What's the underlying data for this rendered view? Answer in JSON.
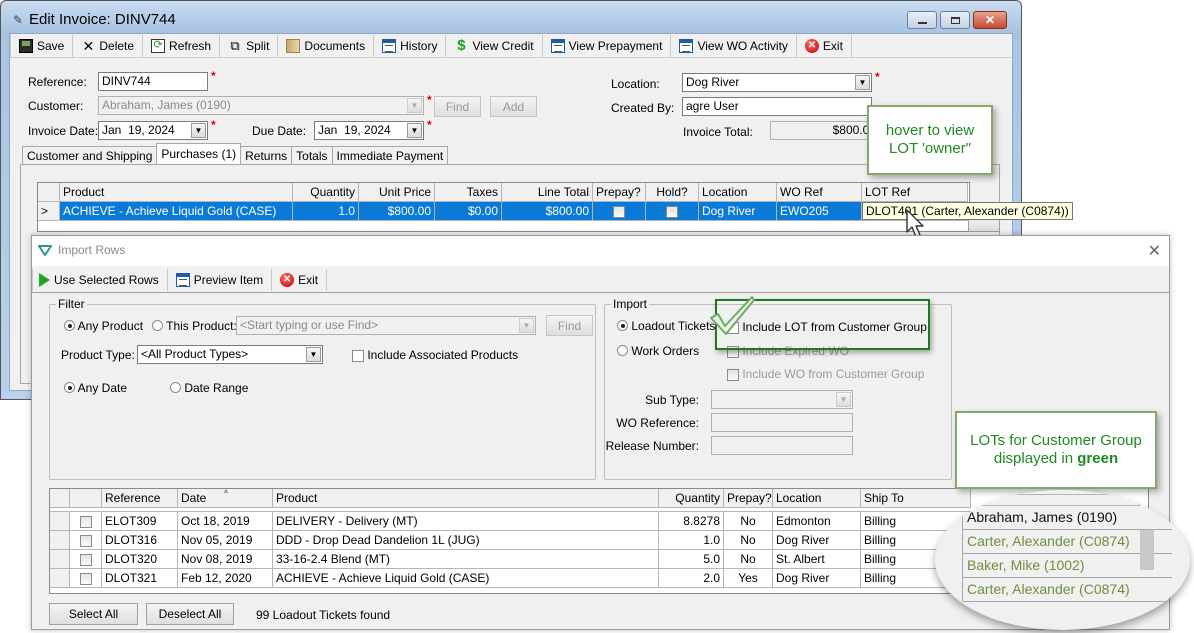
{
  "main_window": {
    "title": "Edit Invoice: DINV744",
    "toolbar": [
      {
        "id": "save",
        "label": "Save",
        "icon": "save-icon"
      },
      {
        "id": "delete",
        "label": "Delete",
        "icon": "x-icon"
      },
      {
        "id": "refresh",
        "label": "Refresh",
        "icon": "refresh-icon"
      },
      {
        "id": "split",
        "label": "Split",
        "icon": "split-icon"
      },
      {
        "id": "documents",
        "label": "Documents",
        "icon": "documents-icon"
      },
      {
        "id": "history",
        "label": "History",
        "icon": "list-icon"
      },
      {
        "id": "view-credit",
        "label": "View Credit",
        "icon": "dollar-icon"
      },
      {
        "id": "view-prepayment",
        "label": "View Prepayment",
        "icon": "list-icon"
      },
      {
        "id": "view-wo-activity",
        "label": "View WO Activity",
        "icon": "list-icon"
      },
      {
        "id": "exit",
        "label": "Exit",
        "icon": "exit-icon"
      }
    ],
    "form": {
      "reference_label": "Reference:",
      "reference_value": "DINV744",
      "customer_label": "Customer:",
      "customer_value": "Abraham, James (0190)",
      "find_label": "Find",
      "add_label": "Add",
      "invoice_date_label": "Invoice Date:",
      "invoice_date_value": "Jan  19, 2024",
      "due_date_label": "Due Date:",
      "due_date_value": "Jan  19, 2024",
      "location_label": "Location:",
      "location_value": "Dog River",
      "created_by_label": "Created By:",
      "created_by_value": "agre User",
      "invoice_total_label": "Invoice Total:",
      "invoice_total_value": "$800.00",
      "required_mark": "*"
    },
    "tabs": [
      "Customer and Shipping",
      "Purchases (1)",
      "Returns",
      "Totals",
      "Immediate Payment"
    ],
    "active_tab": "Purchases (1)",
    "grid": {
      "columns": [
        "Product",
        "Quantity",
        "Unit Price",
        "Taxes",
        "Line Total",
        "Prepay?",
        "Hold?",
        "Location",
        "WO Ref",
        "LOT Ref"
      ],
      "rows": [
        {
          "indicator": ">",
          "product": "ACHIEVE - Achieve Liquid Gold (CASE)",
          "quantity": "1.0",
          "unit_price": "$800.00",
          "taxes": "$0.00",
          "line_total": "$800.00",
          "prepay": false,
          "hold": false,
          "location": "Dog River",
          "wo_ref": "EWO205",
          "lot_ref": "DLOT401"
        }
      ]
    },
    "tooltip": "DLOT401 (Carter, Alexander (C0874))"
  },
  "callouts": {
    "hover": "hover to view LOT 'owner\"",
    "green_prefix": "LOTs for Customer Group displayed in ",
    "green_word": "green"
  },
  "import_window": {
    "title": "Import Rows",
    "toolbar": [
      {
        "id": "use-selected-rows",
        "label": "Use Selected Rows"
      },
      {
        "id": "preview-item",
        "label": "Preview Item"
      },
      {
        "id": "exit",
        "label": "Exit"
      }
    ],
    "filter": {
      "title": "Filter",
      "any_product": "Any Product",
      "this_product": "This Product:",
      "product_placeholder": "<Start typing or use Find>",
      "find_label": "Find",
      "product_type_label": "Product Type:",
      "product_type_value": "<All Product Types>",
      "include_associated": "Include Associated Products",
      "any_date": "Any Date",
      "date_range": "Date Range",
      "selected_product_option": "Any Product",
      "selected_date_option": "Any Date"
    },
    "import": {
      "title": "Import",
      "loadout_tickets": "Loadout Tickets",
      "work_orders": "Work Orders",
      "selected_option": "Loadout Tickets",
      "include_lot_customer_group": "Include LOT from Customer Group",
      "include_lot_customer_group_checked": true,
      "include_expired_wo": "Include Expired WO",
      "include_wo_customer_group": "Include WO from Customer Group",
      "sub_type_label": "Sub Type:",
      "wo_reference_label": "WO Reference:",
      "release_number_label": "Release Number:"
    },
    "grid": {
      "columns": [
        "Reference",
        "Date",
        "Product",
        "Quantity",
        "Prepay?",
        "Location",
        "Ship To"
      ],
      "rows": [
        {
          "reference": "ELOT309",
          "date": "Oct 18, 2019",
          "product": "DELIVERY - Delivery (MT)",
          "quantity": "8.8278",
          "prepay": "No",
          "location": "Edmonton",
          "ship_to": "Billing"
        },
        {
          "reference": "DLOT316",
          "date": "Nov 05, 2019",
          "product": "DDD - Drop Dead Dandelion 1L (JUG)",
          "quantity": "1.0",
          "prepay": "No",
          "location": "Dog River",
          "ship_to": "Billing"
        },
        {
          "reference": "DLOT320",
          "date": "Nov 08, 2019",
          "product": "33-16-2.4 Blend (MT)",
          "quantity": "5.0",
          "prepay": "No",
          "location": "St. Albert",
          "ship_to": "Billing"
        },
        {
          "reference": "DLOT321",
          "date": "Feb 12, 2020",
          "product": "ACHIEVE - Achieve Liquid Gold (CASE)",
          "quantity": "2.0",
          "prepay": "Yes",
          "location": "Dog River",
          "ship_to": "Billing"
        }
      ]
    },
    "select_all": "Select All",
    "deselect_all": "Deselect All",
    "status": "99 Loadout Tickets found"
  },
  "magnified_customers": [
    {
      "name": "Abraham, James (0190)",
      "group": false
    },
    {
      "name": "Carter, Alexander (C0874)",
      "group": true
    },
    {
      "name": "Baker, Mike (1002)",
      "group": true
    },
    {
      "name": "Carter, Alexander (C0874)",
      "group": true
    }
  ],
  "colors": {
    "selection_blue": "#0a7ad8",
    "callout_green": "#1f8a1f",
    "group_customer_green": "#6f8f3c",
    "required_red": "#e00000"
  }
}
